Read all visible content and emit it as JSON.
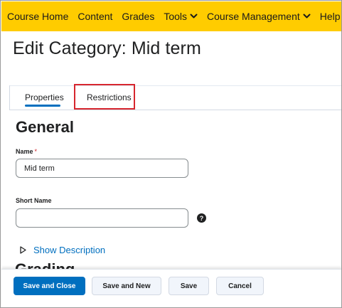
{
  "navbar": {
    "items": [
      {
        "label": "Course Home",
        "dropdown": false
      },
      {
        "label": "Content",
        "dropdown": false
      },
      {
        "label": "Grades",
        "dropdown": false
      },
      {
        "label": "Tools",
        "dropdown": true
      },
      {
        "label": "Course Management",
        "dropdown": true
      },
      {
        "label": "Help",
        "dropdown": true
      }
    ],
    "background": "#ffcc00"
  },
  "page": {
    "title": "Edit Category: Mid term"
  },
  "tabs": {
    "items": [
      {
        "label": "Properties",
        "selected": true
      },
      {
        "label": "Restrictions",
        "selected": false,
        "highlighted": true
      }
    ],
    "accent": "#006fbf",
    "highlight_color": "#d7262e"
  },
  "general": {
    "section_title": "General",
    "name_label": "Name",
    "required_marker": "*",
    "name_value": "Mid term",
    "short_name_label": "Short Name",
    "short_name_value": "",
    "help_icon": "question-circle-icon",
    "show_description": "Show Description"
  },
  "grading": {
    "section_title": "Grading"
  },
  "footer": {
    "save_and_close": "Save and Close",
    "save_and_new": "Save and New",
    "save": "Save",
    "cancel": "Cancel"
  }
}
